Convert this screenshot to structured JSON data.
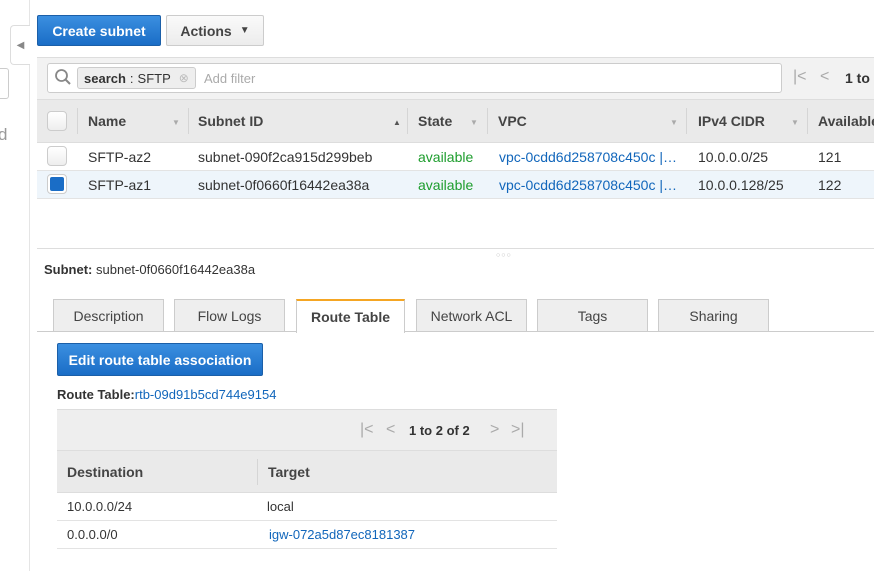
{
  "sidebar": {
    "partial_text": "d"
  },
  "toolbar": {
    "create_label": "Create subnet",
    "actions_label": "Actions"
  },
  "filter": {
    "tag": "search : SFTP",
    "tag_key": "search",
    "tag_value": "SFTP",
    "placeholder": "Add filter",
    "pagination": "1 to"
  },
  "table": {
    "columns": [
      "Name",
      "Subnet ID",
      "State",
      "VPC",
      "IPv4 CIDR",
      "Available"
    ],
    "rows": [
      {
        "name": "SFTP-az2",
        "subnet_id": "subnet-090f2ca915d299beb",
        "state": "available",
        "vpc": "vpc-0cdd6d258708c450c |…",
        "cidr": "10.0.0.0/25",
        "available": "121",
        "selected": false
      },
      {
        "name": "SFTP-az1",
        "subnet_id": "subnet-0f0660f16442ea38a",
        "state": "available",
        "vpc": "vpc-0cdd6d258708c450c |…",
        "cidr": "10.0.0.128/25",
        "available": "122",
        "selected": true
      }
    ]
  },
  "details": {
    "subnet_label": "Subnet:",
    "subnet_value": "subnet-0f0660f16442ea38a",
    "tabs": [
      "Description",
      "Flow Logs",
      "Route Table",
      "Network ACL",
      "Tags",
      "Sharing"
    ],
    "active_tab": "Route Table",
    "edit_button": "Edit route table association",
    "route_table_label": "Route Table:",
    "route_table_id": "rtb-09d91b5cd744e9154",
    "pagination": "1 to 2 of 2",
    "route_columns": [
      "Destination",
      "Target"
    ],
    "routes": [
      {
        "destination": "10.0.0.0/24",
        "target": "local",
        "target_link": false
      },
      {
        "destination": "0.0.0.0/0",
        "target": "igw-072a5d87ec8181387",
        "target_link": true
      }
    ]
  },
  "colors": {
    "primary": "#1a6dc6",
    "link": "#1166bb",
    "available": "#1d9d2d",
    "active_tab": "#f5a623",
    "selected_row": "#eef5fb"
  }
}
